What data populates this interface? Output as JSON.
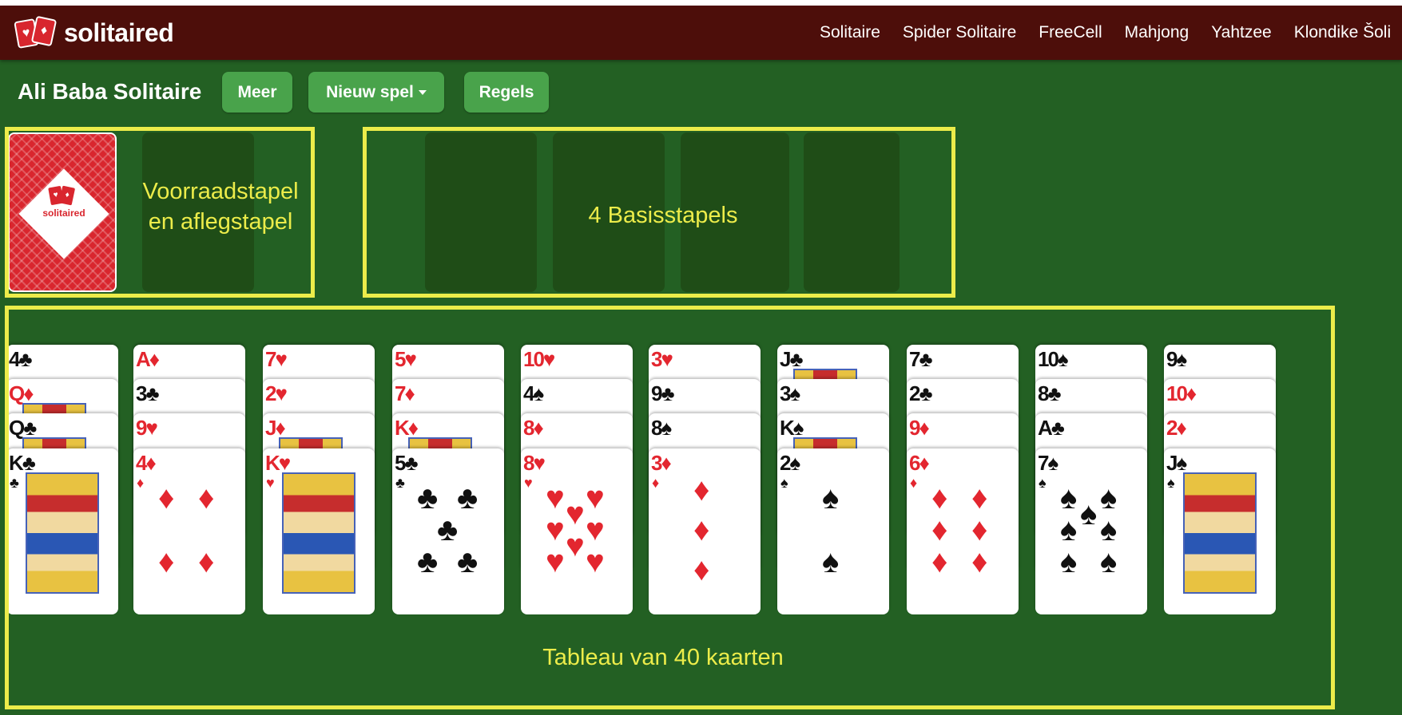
{
  "brand": {
    "name": "solitaired",
    "logo_icon": "playing-cards-logo"
  },
  "nav": {
    "links": [
      "Solitaire",
      "Spider Solitaire",
      "FreeCell",
      "Mahjong",
      "Yahtzee",
      "Klondike Šoli"
    ]
  },
  "toolbar": {
    "title": "Ali Baba Solitaire",
    "meer": "Meer",
    "nieuw": "Nieuw spel",
    "regels": "Regels"
  },
  "labels": {
    "stock_line1": "Voorraadstapel",
    "stock_line2": "en aflegstapel",
    "foundations": "4 Basisstapels",
    "tableau": "Tableau van 40 kaarten"
  },
  "colors": {
    "felt": "#236023",
    "navbar": "#4d0e0a",
    "button": "#49a34b",
    "highlight": "#ecec4a",
    "card_red": "#e3262f",
    "card_back": "#d9262e"
  },
  "tableau": [
    {
      "cards": [
        {
          "rank": "4",
          "suit": "♣",
          "color": "black"
        },
        {
          "rank": "Q",
          "suit": "♦",
          "color": "red"
        },
        {
          "rank": "Q",
          "suit": "♣",
          "color": "black"
        },
        {
          "rank": "K",
          "suit": "♣",
          "color": "black"
        }
      ]
    },
    {
      "cards": [
        {
          "rank": "A",
          "suit": "♦",
          "color": "red"
        },
        {
          "rank": "3",
          "suit": "♣",
          "color": "black"
        },
        {
          "rank": "9",
          "suit": "♥",
          "color": "red"
        },
        {
          "rank": "4",
          "suit": "♦",
          "color": "red"
        }
      ]
    },
    {
      "cards": [
        {
          "rank": "7",
          "suit": "♥",
          "color": "red"
        },
        {
          "rank": "2",
          "suit": "♥",
          "color": "red"
        },
        {
          "rank": "J",
          "suit": "♦",
          "color": "red"
        },
        {
          "rank": "K",
          "suit": "♥",
          "color": "red"
        }
      ]
    },
    {
      "cards": [
        {
          "rank": "5",
          "suit": "♥",
          "color": "red"
        },
        {
          "rank": "7",
          "suit": "♦",
          "color": "red"
        },
        {
          "rank": "K",
          "suit": "♦",
          "color": "red"
        },
        {
          "rank": "5",
          "suit": "♣",
          "color": "black"
        }
      ]
    },
    {
      "cards": [
        {
          "rank": "10",
          "suit": "♥",
          "color": "red"
        },
        {
          "rank": "4",
          "suit": "♠",
          "color": "black"
        },
        {
          "rank": "8",
          "suit": "♦",
          "color": "red"
        },
        {
          "rank": "8",
          "suit": "♥",
          "color": "red"
        }
      ]
    },
    {
      "cards": [
        {
          "rank": "3",
          "suit": "♥",
          "color": "red"
        },
        {
          "rank": "9",
          "suit": "♣",
          "color": "black"
        },
        {
          "rank": "8",
          "suit": "♠",
          "color": "black"
        },
        {
          "rank": "3",
          "suit": "♦",
          "color": "red"
        }
      ]
    },
    {
      "cards": [
        {
          "rank": "J",
          "suit": "♣",
          "color": "black"
        },
        {
          "rank": "3",
          "suit": "♠",
          "color": "black"
        },
        {
          "rank": "K",
          "suit": "♠",
          "color": "black"
        },
        {
          "rank": "2",
          "suit": "♠",
          "color": "black"
        }
      ]
    },
    {
      "cards": [
        {
          "rank": "7",
          "suit": "♣",
          "color": "black"
        },
        {
          "rank": "2",
          "suit": "♣",
          "color": "black"
        },
        {
          "rank": "9",
          "suit": "♦",
          "color": "red"
        },
        {
          "rank": "6",
          "suit": "♦",
          "color": "red"
        }
      ]
    },
    {
      "cards": [
        {
          "rank": "10",
          "suit": "♠",
          "color": "black"
        },
        {
          "rank": "8",
          "suit": "♣",
          "color": "black"
        },
        {
          "rank": "A",
          "suit": "♣",
          "color": "black"
        },
        {
          "rank": "7",
          "suit": "♠",
          "color": "black"
        }
      ]
    },
    {
      "cards": [
        {
          "rank": "9",
          "suit": "♠",
          "color": "black"
        },
        {
          "rank": "10",
          "suit": "♦",
          "color": "red"
        },
        {
          "rank": "2",
          "suit": "♦",
          "color": "red"
        },
        {
          "rank": "J",
          "suit": "♠",
          "color": "black"
        }
      ]
    }
  ]
}
